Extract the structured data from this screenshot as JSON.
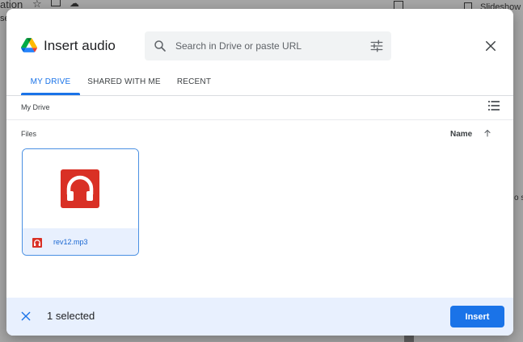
{
  "background": {
    "title_fragment": "ation",
    "se_fragment": "se",
    "slideshow_label": "Slideshow",
    "right_fragment": "o s"
  },
  "dialog": {
    "title": "Insert audio",
    "search": {
      "placeholder": "Search in Drive or paste URL",
      "value": ""
    },
    "tabs": [
      {
        "label": "MY DRIVE",
        "active": true
      },
      {
        "label": "SHARED WITH ME",
        "active": false
      },
      {
        "label": "RECENT",
        "active": false
      }
    ],
    "breadcrumb": "My Drive",
    "section_label": "Files",
    "sort": {
      "label": "Name",
      "direction": "ascending"
    },
    "files": [
      {
        "name": "rev12.mp3",
        "type": "audio",
        "selected": true
      }
    ],
    "footer": {
      "selected_text": "1 selected",
      "insert_label": "Insert"
    }
  },
  "colors": {
    "accent": "#1a73e8",
    "audio_red": "#d93025",
    "selection_bg": "#e8f0fe"
  },
  "icons": {
    "logo": "google-drive-icon",
    "search": "search-icon",
    "tune": "tune-icon",
    "close": "close-icon",
    "list_view": "list-view-icon",
    "sort": "arrow-up-icon",
    "audio": "headphones-icon",
    "deselect": "close-icon"
  }
}
